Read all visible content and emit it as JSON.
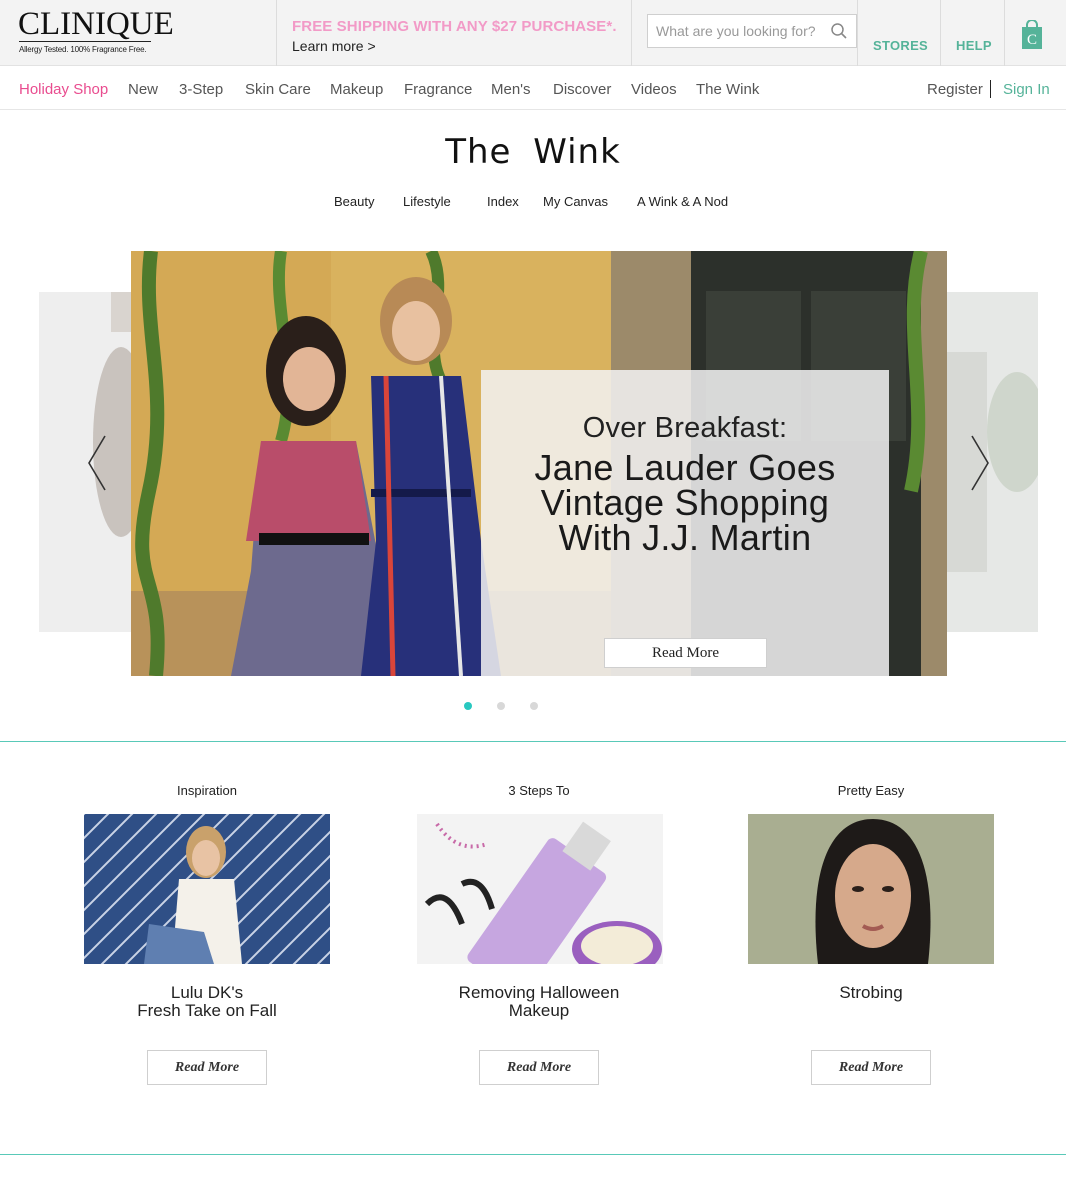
{
  "brand": {
    "name": "CLINIQUE",
    "tagline": "Allergy Tested. 100% Fragrance Free."
  },
  "promo": {
    "headline": "FREE SHIPPING WITH ANY $27 PURCHASE*.",
    "link": "Learn more >"
  },
  "search": {
    "placeholder": "What are you looking for?",
    "icon": "search-icon"
  },
  "utility": {
    "stores": "STORES",
    "help": "HELP",
    "bag_icon": "shopping-bag-icon"
  },
  "colors": {
    "accent_pink": "#e94c8f",
    "accent_green": "#55b399",
    "promo_pink": "#f29ac7",
    "teal": "#28c8c0"
  },
  "nav": {
    "items": [
      "Holiday Shop",
      "New",
      "3-Step",
      "Skin Care",
      "Makeup",
      "Fragrance",
      "Men's",
      "Discover",
      "Videos",
      "The Wink"
    ],
    "active": "Holiday Shop",
    "register": "Register",
    "signin": "Sign In"
  },
  "wink": {
    "title": "The  Wink",
    "subnav": [
      "Beauty",
      "Lifestyle",
      "Index",
      "My Canvas",
      "A Wink & A Nod"
    ]
  },
  "hero": {
    "kicker": "Over Breakfast:",
    "headline": "Jane Lauder Goes Vintage Shopping With J.J. Martin",
    "button": "Read More",
    "active_slide": 1,
    "slide_count": 3
  },
  "cards": [
    {
      "category": "Inspiration",
      "title": "Lulu DK's\nFresh Take on Fall",
      "button": "Read More"
    },
    {
      "category": "3 Steps To",
      "title": "Removing Halloween\nMakeup",
      "button": "Read More"
    },
    {
      "category": "Pretty Easy",
      "title": "Strobing",
      "button": "Read More"
    }
  ]
}
